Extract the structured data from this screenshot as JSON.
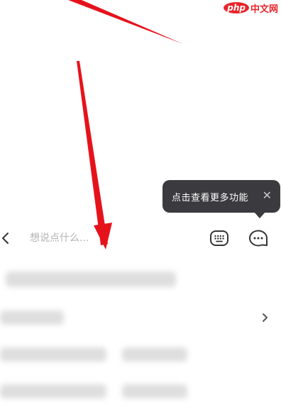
{
  "watermark": {
    "logo": "php",
    "text": "中文网"
  },
  "tooltip": {
    "text": "点击查看更多功能",
    "close_glyph": "✕"
  },
  "input_bar": {
    "placeholder": "想说点什么..."
  },
  "icons": {
    "back": "chevron-left-icon",
    "keyboard": "keyboard-icon",
    "more": "more-chat-icon",
    "row": "chevron-right-icon",
    "tooltip_close": "close-icon"
  },
  "colors": {
    "tooltip_bg": "#3b3b3f",
    "arrow": "#e6121b",
    "placeholder": "#b4b4b4",
    "icon": "#333333"
  }
}
